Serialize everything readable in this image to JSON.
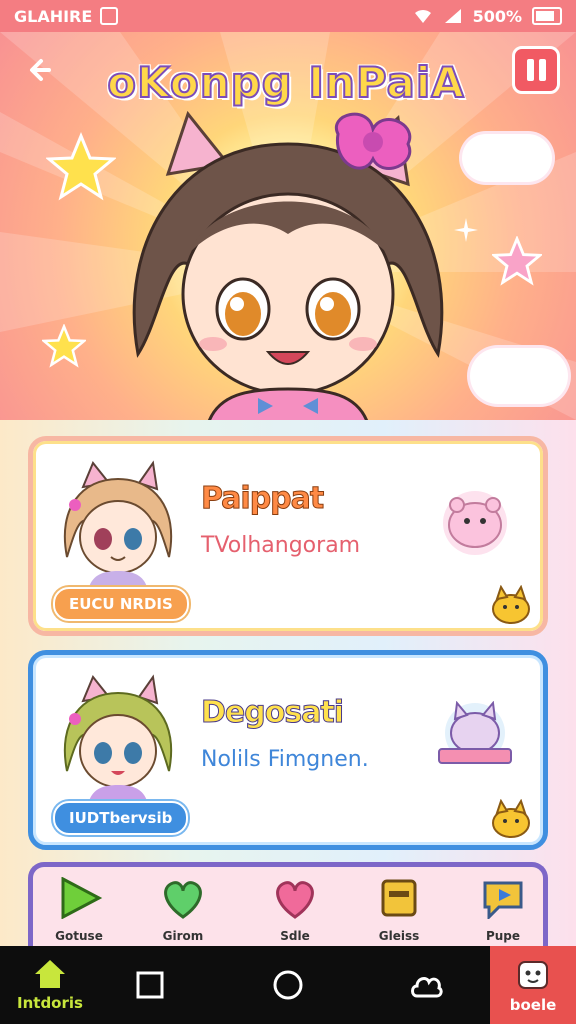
{
  "status_bar": {
    "carrier": "GLAHIRE",
    "battery": "500%"
  },
  "header": {
    "title": "oKonpg InPaiA"
  },
  "cards": [
    {
      "name": "Paippat",
      "subtitle": "TVolhangoram",
      "tag": "EUCU NRDIS"
    },
    {
      "name": "Degosati",
      "subtitle": "Nolils Fimgnen.",
      "tag": "IUDTbervsib"
    }
  ],
  "features": [
    {
      "label": "Gotuse",
      "icon": "play-triangle-icon"
    },
    {
      "label": "Girom",
      "icon": "heart-leaf-icon"
    },
    {
      "label": "Sdle",
      "icon": "heart-icon"
    },
    {
      "label": "Gleiss",
      "icon": "chest-icon"
    },
    {
      "label": "Pupe",
      "icon": "chat-play-icon"
    }
  ],
  "bottom_nav": [
    {
      "label": "Intdoris",
      "icon": "home-icon"
    },
    {
      "label": "",
      "icon": "recent-apps-icon"
    },
    {
      "label": "",
      "icon": "home-circle-icon"
    },
    {
      "label": "",
      "icon": "cloud-icon"
    },
    {
      "label": "boele",
      "icon": "profile-icon"
    }
  ],
  "colors": {
    "accent": "#f15a63",
    "hero_bg": "#ffd67a",
    "card1_border": "#f7b7a3",
    "card2_border": "#3f8fe0",
    "nav_active": "#c8e63c"
  }
}
